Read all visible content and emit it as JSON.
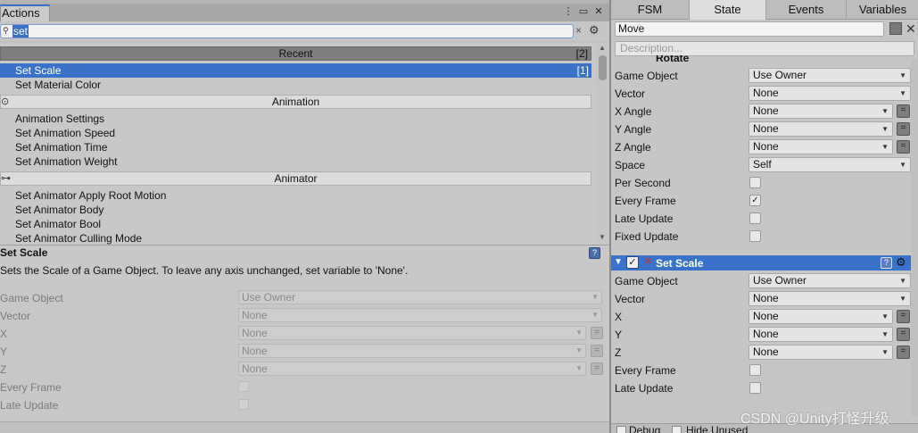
{
  "actions_panel": {
    "tab_label": "Actions",
    "search": {
      "value": "set"
    },
    "categories": [
      {
        "name": "Recent",
        "count": "[2]",
        "items": [
          {
            "label": "Set Scale",
            "count": "[1]",
            "selected": true
          },
          {
            "label": "Set Material Color",
            "count": ""
          }
        ]
      },
      {
        "name": "Animation",
        "count": "",
        "items": [
          {
            "label": "Animation Settings"
          },
          {
            "label": "Set Animation Speed"
          },
          {
            "label": "Set Animation Time"
          },
          {
            "label": "Set Animation Weight"
          }
        ]
      },
      {
        "name": "Animator",
        "count": "",
        "items": [
          {
            "label": "Set Animator Apply Root Motion"
          },
          {
            "label": "Set Animator Body"
          },
          {
            "label": "Set Animator Bool"
          },
          {
            "label": "Set Animator Culling Mode"
          }
        ]
      }
    ],
    "detail": {
      "title": "Set Scale",
      "description": "Sets the Scale of a Game Object. To leave any axis unchanged, set variable to 'None'.",
      "params": [
        {
          "label": "Game Object",
          "value": "Use Owner",
          "kind": "select"
        },
        {
          "label": "Vector",
          "value": "None",
          "kind": "select"
        },
        {
          "label": "X",
          "value": "None",
          "kind": "select-eq"
        },
        {
          "label": "Y",
          "value": "None",
          "kind": "select-eq"
        },
        {
          "label": "Z",
          "value": "None",
          "kind": "select-eq"
        },
        {
          "label": "Every Frame",
          "value": "",
          "kind": "check"
        },
        {
          "label": "Late Update",
          "value": "",
          "kind": "check"
        }
      ]
    }
  },
  "fsm_panel": {
    "tabs": [
      "FSM",
      "State",
      "Events",
      "Variables"
    ],
    "active_tab": "State",
    "state_name": "Move",
    "description_placeholder": "Description...",
    "rotate_action": {
      "title": "Rotate",
      "params": [
        {
          "label": "Game Object",
          "value": "Use Owner",
          "kind": "select"
        },
        {
          "label": "Vector",
          "value": "None",
          "kind": "select"
        },
        {
          "label": "X Angle",
          "value": "None",
          "kind": "select-eq"
        },
        {
          "label": "Y Angle",
          "value": "None",
          "kind": "select-eq"
        },
        {
          "label": "Z Angle",
          "value": "None",
          "kind": "select-eq"
        },
        {
          "label": "Space",
          "value": "Self",
          "kind": "select"
        },
        {
          "label": "Per Second",
          "checked": false,
          "kind": "check"
        },
        {
          "label": "Every Frame",
          "checked": true,
          "kind": "check"
        },
        {
          "label": "Late Update",
          "checked": false,
          "kind": "check"
        },
        {
          "label": "Fixed Update",
          "checked": false,
          "kind": "check"
        }
      ]
    },
    "setscale_action": {
      "title": "Set Scale",
      "enabled": true,
      "params": [
        {
          "label": "Game Object",
          "value": "Use Owner",
          "kind": "select"
        },
        {
          "label": "Vector",
          "value": "None",
          "kind": "select"
        },
        {
          "label": "X",
          "value": "None",
          "kind": "select-eq"
        },
        {
          "label": "Y",
          "value": "None",
          "kind": "select-eq"
        },
        {
          "label": "Z",
          "value": "None",
          "kind": "select-eq"
        },
        {
          "label": "Every Frame",
          "checked": false,
          "kind": "check"
        },
        {
          "label": "Late Update",
          "checked": false,
          "kind": "check"
        }
      ]
    },
    "footer": {
      "debug_label": "Debug",
      "hide_unused_label": "Hide Unused"
    }
  },
  "watermark": "CSDN @Unity打怪升级",
  "colors": {
    "selection": "#3a72c9",
    "panel": "#c6c6c6"
  },
  "icons": [
    "search-icon",
    "close-icon",
    "gear-icon",
    "menu-icon",
    "maximize-icon",
    "help-icon",
    "check-icon",
    "chevron-down-icon"
  ]
}
